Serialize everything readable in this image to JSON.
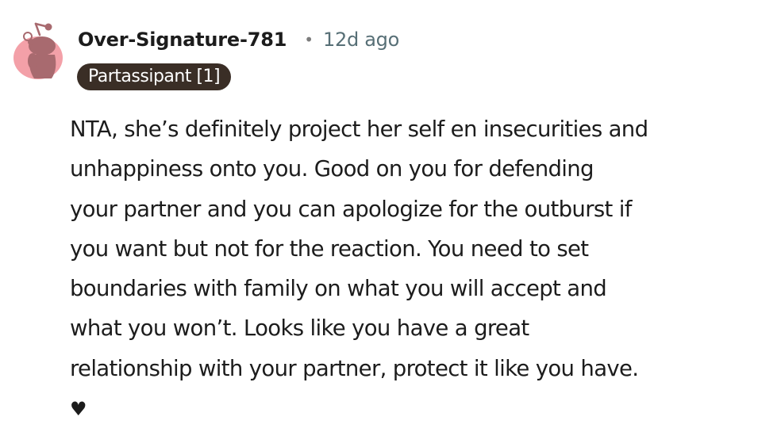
{
  "comment": {
    "author": "Over-Signature-781",
    "separator": "•",
    "timestamp": "12d ago",
    "flair": "Partassipant [1]",
    "body_lines": [
      "NTA, she’s definitely project her self en insecurities and",
      "unhappiness onto you. Good on you for defending",
      "your partner and you can apologize for the outburst if",
      "you want but not for the reaction. You need to set",
      "boundaries with family on what you will accept and",
      "what you won’t. Looks like you have a great",
      "relationship with your partner, protect it like you have."
    ],
    "heart": "♥"
  },
  "avatar": {
    "icon": "snoo-avatar-icon",
    "background_color": "#f3a0a8",
    "figure_color": "#a86a6f"
  },
  "colors": {
    "text": "#1c1c1c",
    "meta": "#576f76",
    "flair_bg": "#3a2e26",
    "flair_text": "#ffffff"
  }
}
